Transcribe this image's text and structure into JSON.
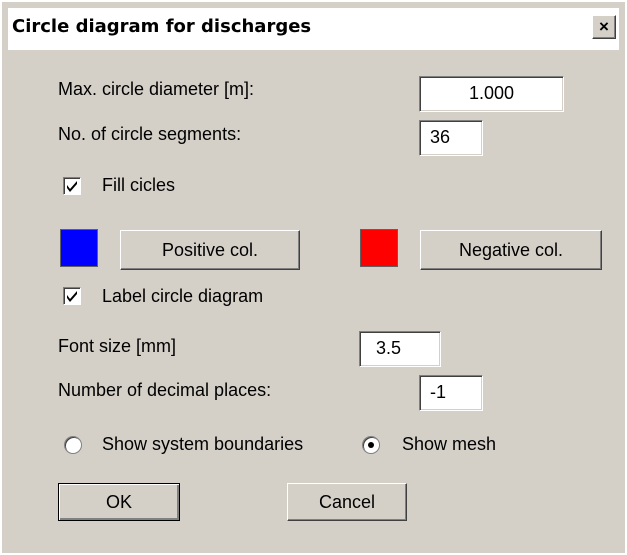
{
  "dialog": {
    "title": "Circle diagram for discharges",
    "close_glyph": "×"
  },
  "fields": {
    "max_diameter": {
      "label": "Max. circle diameter [m]:",
      "value": "1.000"
    },
    "segments": {
      "label": "No. of circle segments:",
      "value": "36"
    },
    "font_size": {
      "label": "Font size [mm]",
      "value": "3.5"
    },
    "decimals": {
      "label": "Number of decimal places:",
      "value": "-1"
    }
  },
  "checkboxes": {
    "fill": {
      "label": "Fill cicles",
      "checked": true
    },
    "label_diagram": {
      "label": "Label circle diagram",
      "checked": true
    }
  },
  "colors": {
    "positive": {
      "swatch": "#0000ff",
      "button_label": "Positive col."
    },
    "negative": {
      "swatch": "#ff0000",
      "button_label": "Negative col."
    }
  },
  "radios": {
    "boundaries": {
      "label": "Show system boundaries",
      "selected": false
    },
    "mesh": {
      "label": "Show mesh",
      "selected": true
    }
  },
  "buttons": {
    "ok": "OK",
    "cancel": "Cancel"
  }
}
